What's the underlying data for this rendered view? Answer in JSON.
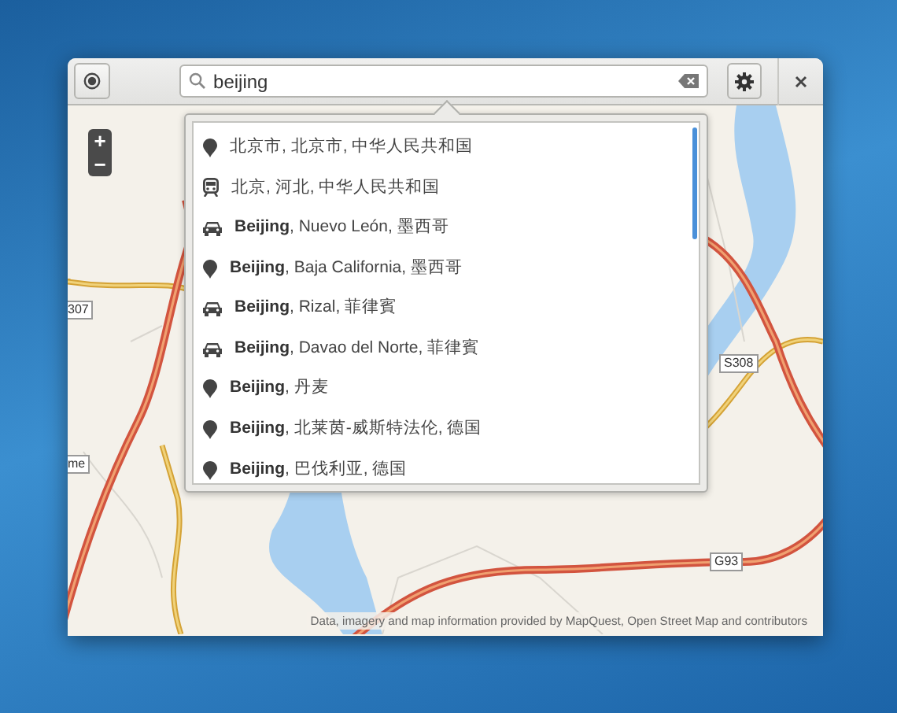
{
  "search": {
    "value": "beijing"
  },
  "results": [
    {
      "kind": "place",
      "text": "北京市, 北京市, 中华人民共和国"
    },
    {
      "kind": "train",
      "text": "北京, 河北, 中华人民共和国"
    },
    {
      "kind": "car",
      "text": "**Beijing**, Nuevo León, 墨西哥"
    },
    {
      "kind": "place",
      "text": "**Beijing**, Baja California, 墨西哥"
    },
    {
      "kind": "car",
      "text": "**Beijing**, Rizal, 菲律賓"
    },
    {
      "kind": "car",
      "text": "**Beijing**, Davao del Norte, 菲律賓"
    },
    {
      "kind": "place",
      "text": "**Beijing**, 丹麦"
    },
    {
      "kind": "place",
      "text": "**Beijing**, 北莱茵-威斯特法伦, 德国"
    },
    {
      "kind": "place",
      "text": "**Beijing**, 巴伐利亚, 德国"
    }
  ],
  "map": {
    "zoom_in": "+",
    "zoom_out": "−",
    "road_labels": [
      {
        "text": "307"
      },
      {
        "text": "me"
      },
      {
        "text": "S308"
      },
      {
        "text": "G93"
      }
    ],
    "attribution": "Data, imagery and map information provided by MapQuest, Open Street Map and contributors"
  }
}
